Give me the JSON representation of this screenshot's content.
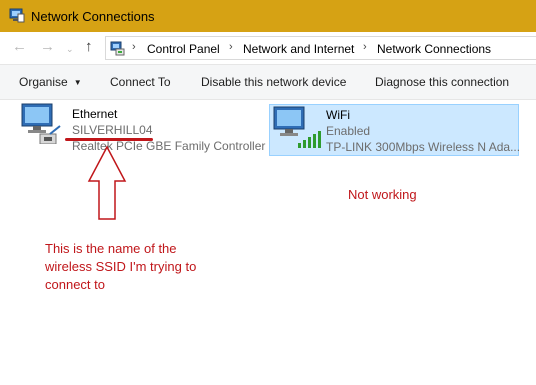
{
  "window": {
    "title": "Network Connections",
    "titlebar_color": "#d6a214"
  },
  "address": {
    "crumbs": [
      "Control Panel",
      "Network and Internet",
      "Network Connections"
    ]
  },
  "toolbar": {
    "organise": "Organise",
    "connect_to": "Connect To",
    "disable": "Disable this network device",
    "diagnose": "Diagnose this connection"
  },
  "adapters": [
    {
      "name": "Ethernet",
      "status": "SILVERHILL04",
      "device": "Realtek PCIe GBE Family Controller",
      "icon": "ethernet-adapter-icon",
      "selected": false
    },
    {
      "name": "WiFi",
      "status": "Enabled",
      "device": "TP-LINK 300Mbps Wireless N Ada...",
      "icon": "wifi-adapter-icon",
      "selected": true
    }
  ],
  "annotations": {
    "note": "This is the name of the wireless SSID I'm trying to connect to",
    "not_working": "Not working",
    "color": "#c0161a"
  },
  "colors": {
    "selection_bg": "#cce8ff",
    "selection_border": "#99d1ff"
  }
}
